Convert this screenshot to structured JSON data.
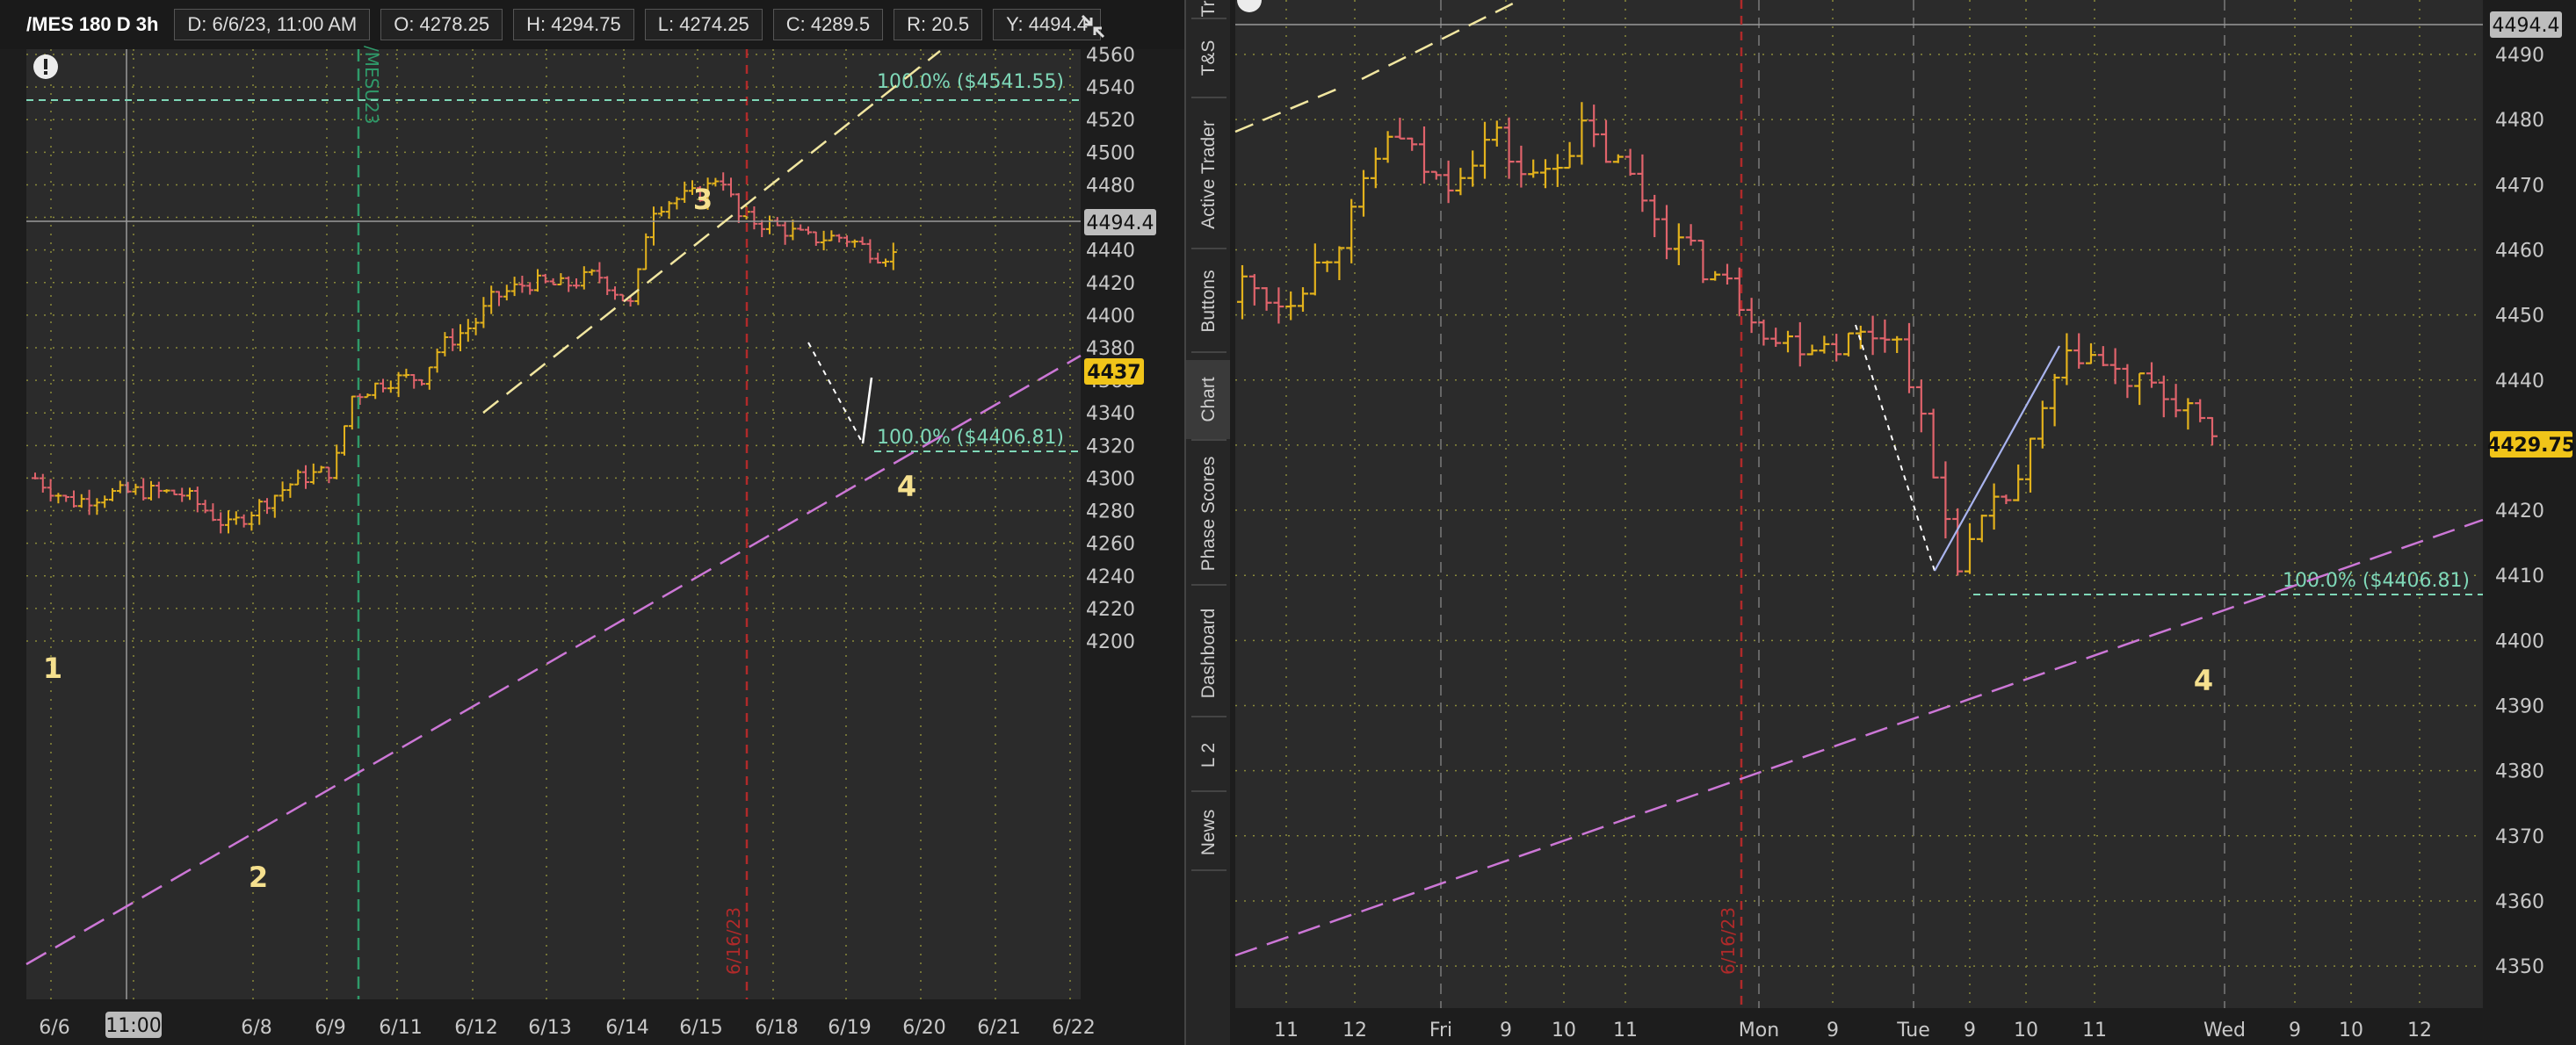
{
  "header": {
    "symbol": "/MES 180 D 3h",
    "date": "D: 6/6/23, 11:00 AM",
    "open": "O: 4278.25",
    "high": "H: 4294.75",
    "low": "L: 4274.25",
    "close": "C: 4289.5",
    "range": "R: 20.5",
    "last": "Y: 4494.4"
  },
  "left_chart": {
    "price_ticks": [
      "4560",
      "4540",
      "4520",
      "4500",
      "4480",
      "4460",
      "4440",
      "4420",
      "4400",
      "4380",
      "4360",
      "4340",
      "4320",
      "4300",
      "4280",
      "4260",
      "4240",
      "4220",
      "4200"
    ],
    "date_ticks": [
      "6/6",
      "11:00",
      "6/8",
      "6/9",
      "6/11",
      "6/12",
      "6/13",
      "6/14",
      "6/15",
      "6/18",
      "6/19",
      "6/20",
      "6/21",
      "6/22"
    ],
    "crosshair_price": "4494.4",
    "current_price": "4437",
    "fib_top": "100.0%  ($4541.55)",
    "fib_bottom": "100.0%  ($4406.81)",
    "wave_labels": [
      "1",
      "2",
      "3",
      "4"
    ],
    "vertical_label_green": "/MESU23",
    "vertical_label_red": "6/16/23"
  },
  "right_chart": {
    "price_ticks": [
      "4490",
      "4480",
      "4470",
      "4460",
      "4450",
      "4440",
      "4430",
      "4420",
      "4410",
      "4400",
      "4390",
      "4380",
      "4370",
      "4360",
      "4350"
    ],
    "time_ticks": [
      "11",
      "12",
      "Fri",
      "9",
      "10",
      "11",
      "Mon",
      "9",
      "Tue",
      "9",
      "10",
      "11",
      "Wed",
      "9",
      "10",
      "12"
    ],
    "crosshair_price": "4494.4",
    "current_price": "4429.75",
    "fib_label": "100.0%  ($4406.81)",
    "wave_label": "4",
    "vertical_label_red": "6/16/23"
  },
  "side_tabs": [
    "Tr",
    "T&S",
    "Active Trader",
    "Buttons",
    "Chart",
    "Phase Scores",
    "Dashboard",
    "L 2",
    "News"
  ],
  "icons": {
    "alert": "alert-icon",
    "link": "link-arrows-icon"
  },
  "colors": {
    "up_bar": "#e3b21c",
    "down_bar": "#e0636b",
    "trend_line": "#cc77d6",
    "channel_line": "#f1e6a0",
    "fib_line": "#7fd8b8",
    "price_badge": "#f0c419",
    "wave_label": "#f5e08e"
  }
}
